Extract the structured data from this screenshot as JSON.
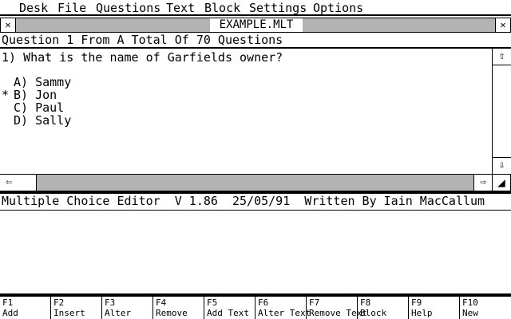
{
  "menubar": {
    "items": [
      "Desk",
      "File",
      "Questions",
      "Text",
      "Block",
      "Settings",
      "Options"
    ]
  },
  "window": {
    "title": "EXAMPLE.MLT",
    "close_glyph": "✕",
    "fuller_glyph": "✕"
  },
  "info": {
    "question_header": "Question 1 From A Total Of 70 Questions"
  },
  "question": {
    "text": "1) What is the name of Garfields owner?",
    "options": [
      {
        "marker": "",
        "label": "A) Sammy"
      },
      {
        "marker": "*",
        "label": "B) Jon"
      },
      {
        "marker": "",
        "label": "C) Paul"
      },
      {
        "marker": "",
        "label": "D) Sally"
      }
    ]
  },
  "scroll": {
    "up": "⇧",
    "down": "⇩",
    "left": "⇦",
    "right": "⇨",
    "size": "◢"
  },
  "status": {
    "text": "Multiple Choice Editor  V 1.86  25/05/91  Written By Iain MacCallum"
  },
  "fkeys": [
    {
      "key": "F1",
      "label": "Add"
    },
    {
      "key": "F2",
      "label": "Insert"
    },
    {
      "key": "F3",
      "label": "Alter"
    },
    {
      "key": "F4",
      "label": "Remove"
    },
    {
      "key": "F5",
      "label": "Add Text"
    },
    {
      "key": "F6",
      "label": "Alter Text"
    },
    {
      "key": "F7",
      "label": "Remove Text"
    },
    {
      "key": "F8",
      "label": "Block"
    },
    {
      "key": "F9",
      "label": "Help"
    },
    {
      "key": "F10",
      "label": "New"
    }
  ]
}
